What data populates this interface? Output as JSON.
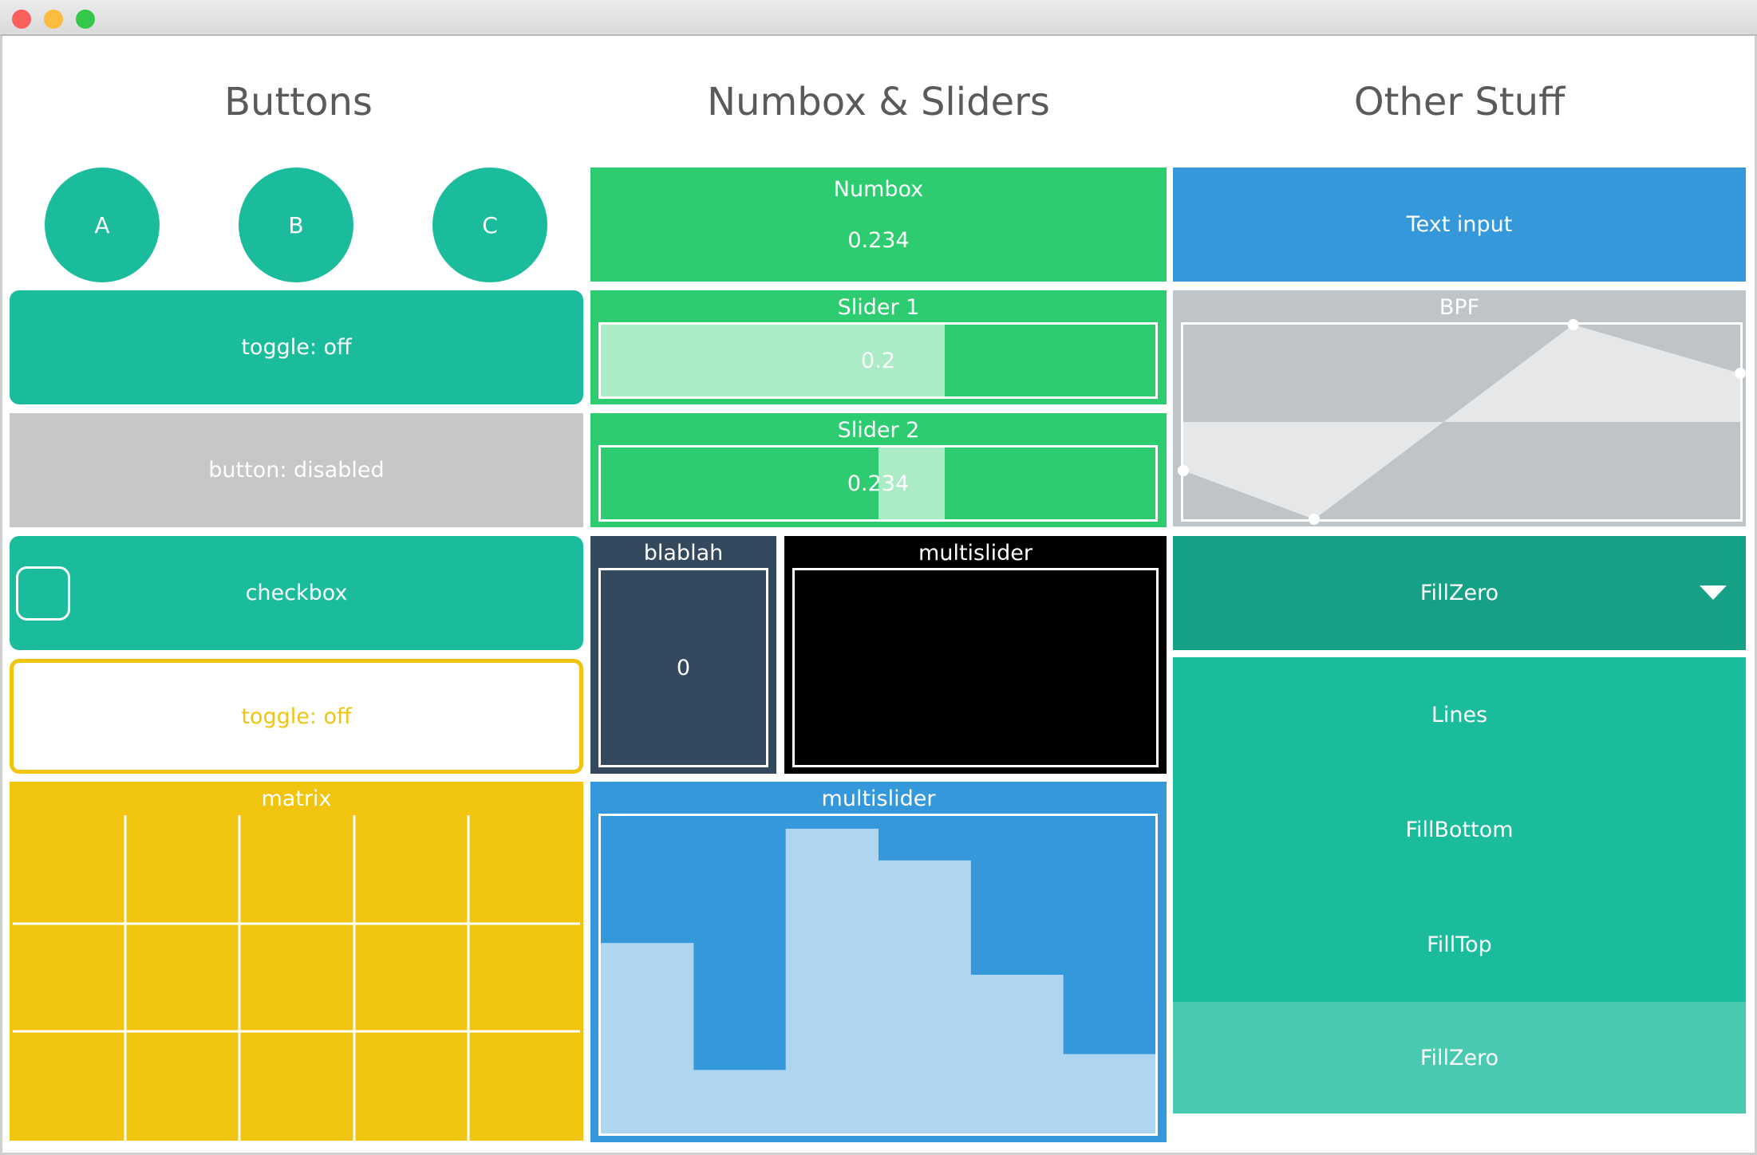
{
  "columns": {
    "buttons": "Buttons",
    "numbox_sliders": "Numbox & Sliders",
    "other": "Other Stuff"
  },
  "buttons": {
    "radio": [
      "A",
      "B",
      "C"
    ],
    "toggle1": "toggle: off",
    "disabled": "button: disabled",
    "checkbox": "checkbox",
    "toggle2": "toggle: off",
    "matrix": {
      "label": "matrix",
      "cols": 5,
      "rows": 3
    }
  },
  "numbox": {
    "label": "Numbox",
    "value": "0.234"
  },
  "slider1": {
    "label": "Slider 1",
    "value": "0.2",
    "fill": 0.62
  },
  "slider2": {
    "label": "Slider 2",
    "value": "0.234",
    "fill_from": 0.5,
    "fill_to": 0.62
  },
  "blablah": {
    "label": "blablah",
    "value": "0"
  },
  "multislider_black": {
    "label": "multislider"
  },
  "multislider_blue": {
    "label": "multislider",
    "values": [
      0.6,
      0.2,
      0.96,
      0.86,
      0.5,
      0.25
    ]
  },
  "other": {
    "text_input": "Text input",
    "bpf": {
      "label": "BPF",
      "points": [
        [
          0,
          0.25
        ],
        [
          0.235,
          0
        ],
        [
          0.7,
          1.0
        ],
        [
          1.0,
          0.75
        ]
      ]
    },
    "dropdown": {
      "selected": "FillZero",
      "options": [
        "Lines",
        "FillBottom",
        "FillTop",
        "FillZero"
      ]
    }
  },
  "colors": {
    "teal": "#1abc9c",
    "green": "#2ecc71",
    "gray": "#c7c7c7",
    "yellow": "#f1c40f",
    "navy": "#34495e",
    "blue": "#3498db",
    "dark_teal": "#16a085",
    "light_teal": "#48c9b0",
    "bpf_bg": "#bfc4c8"
  }
}
